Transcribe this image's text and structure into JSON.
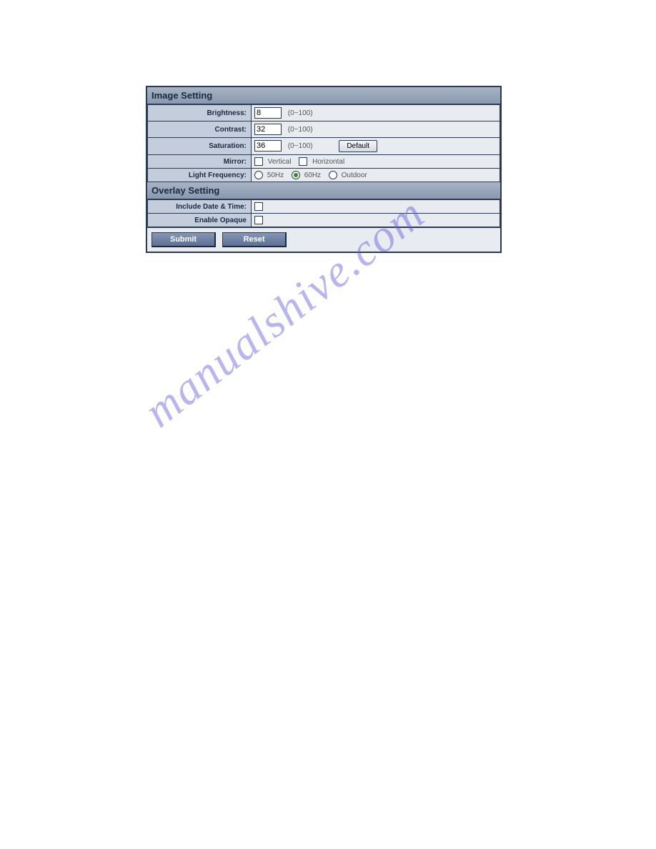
{
  "sections": {
    "image": {
      "title": "Image Setting",
      "brightness": {
        "label": "Brightness:",
        "value": "8",
        "hint": "(0~100)"
      },
      "contrast": {
        "label": "Contrast:",
        "value": "32",
        "hint": "(0~100)"
      },
      "saturation": {
        "label": "Saturation:",
        "value": "36",
        "hint": "(0~100)",
        "default_btn": "Default"
      },
      "mirror": {
        "label": "Mirror:",
        "vertical": "Vertical",
        "horizontal": "Horizontal"
      },
      "lightfreq": {
        "label": "Light Frequency:",
        "opt50": "50Hz",
        "opt60": "60Hz",
        "optOutdoor": "Outdoor"
      }
    },
    "overlay": {
      "title": "Overlay Setting",
      "datetime": {
        "label": "Include Date & Time:"
      },
      "opaque": {
        "label": "Enable Opaque"
      }
    }
  },
  "buttons": {
    "submit": "Submit",
    "reset": "Reset"
  },
  "watermark": "manualshive.com"
}
